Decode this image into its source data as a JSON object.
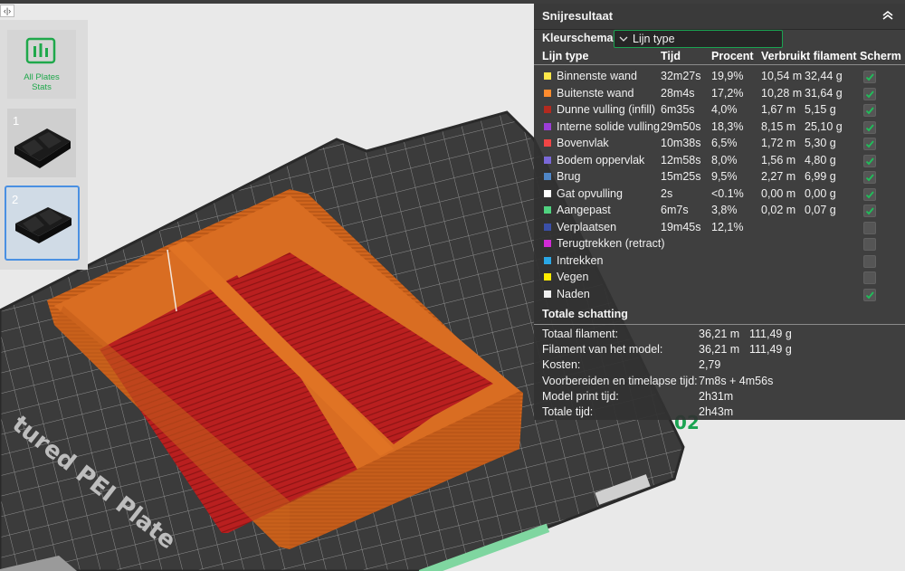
{
  "viewport": {
    "plate_text": "tured PEI Plate",
    "plate_number": "02"
  },
  "sidebar": {
    "stats_label_1": "All Plates",
    "stats_label_2": "Stats",
    "plates": [
      {
        "label": "1"
      },
      {
        "label": "2"
      }
    ]
  },
  "panel": {
    "title": "Snijresultaat",
    "color_scheme_label": "Kleurschema",
    "color_scheme_value": "Lijn type",
    "headers": {
      "type": "Lijn type",
      "time": "Tijd",
      "percent": "Procent",
      "filament": "Verbruikt filament",
      "display": "Scherm"
    },
    "rows": [
      {
        "name": "Binnenste wand",
        "time": "32m27s",
        "percent": "19,9%",
        "length": "10,54 m",
        "weight": "32,44 g",
        "color": "#ffe84a",
        "checked": true
      },
      {
        "name": "Buitenste wand",
        "time": "28m4s",
        "percent": "17,2%",
        "length": "10,28 m",
        "weight": "31,64 g",
        "color": "#ff8c2e",
        "checked": true
      },
      {
        "name": "Dunne vulling (infill)",
        "time": "6m35s",
        "percent": "4,0%",
        "length": "1,67 m",
        "weight": "5,15 g",
        "color": "#b32a1f",
        "checked": true
      },
      {
        "name": "Interne solide vulling",
        "time": "29m50s",
        "percent": "18,3%",
        "length": "8,15 m",
        "weight": "25,10 g",
        "color": "#9b3dd6",
        "checked": true
      },
      {
        "name": "Bovenvlak",
        "time": "10m38s",
        "percent": "6,5%",
        "length": "1,72 m",
        "weight": "5,30 g",
        "color": "#f04545",
        "checked": true
      },
      {
        "name": "Bodem oppervlak",
        "time": "12m58s",
        "percent": "8,0%",
        "length": "1,56 m",
        "weight": "4,80 g",
        "color": "#7a68d8",
        "checked": true
      },
      {
        "name": "Brug",
        "time": "15m25s",
        "percent": "9,5%",
        "length": "2,27 m",
        "weight": "6,99 g",
        "color": "#4f86c6",
        "checked": true
      },
      {
        "name": "Gat opvulling",
        "time": "2s",
        "percent": "<0.1%",
        "length": "0,00 m",
        "weight": "0,00 g",
        "color": "#ffffff",
        "checked": true
      },
      {
        "name": "Aangepast",
        "time": "6m7s",
        "percent": "3,8%",
        "length": "0,02 m",
        "weight": "0,07 g",
        "color": "#4fd27f",
        "checked": true
      },
      {
        "name": "Verplaatsen",
        "time": "19m45s",
        "percent": "12,1%",
        "length": "",
        "weight": "",
        "color": "#3a4fa8",
        "checked": false
      },
      {
        "name": "Terugtrekken (retract)",
        "time": "",
        "percent": "",
        "length": "",
        "weight": "",
        "color": "#d22ad6",
        "checked": false
      },
      {
        "name": "Intrekken",
        "time": "",
        "percent": "",
        "length": "",
        "weight": "",
        "color": "#2aa7e6",
        "checked": false
      },
      {
        "name": "Vegen",
        "time": "",
        "percent": "",
        "length": "",
        "weight": "",
        "color": "#ffec00",
        "checked": false
      },
      {
        "name": "Naden",
        "time": "",
        "percent": "",
        "length": "",
        "weight": "",
        "color": "#f0f0f0",
        "checked": true
      }
    ],
    "summary_title": "Totale schatting",
    "summary": [
      {
        "key": "Totaal filament:",
        "v1": "36,21 m",
        "v2": "111,49 g"
      },
      {
        "key": "Filament van het model:",
        "v1": "36,21 m",
        "v2": "111,49 g"
      },
      {
        "key": "Kosten:",
        "v1": "2,79",
        "v2": ""
      },
      {
        "key": "Voorbereiden en timelapse tijd:",
        "v1": "7m8s + 4m56s",
        "v2": ""
      },
      {
        "key": "Model print tijd:",
        "v1": "2h31m",
        "v2": ""
      },
      {
        "key": "Totale tijd:",
        "v1": "2h43m",
        "v2": ""
      }
    ]
  }
}
